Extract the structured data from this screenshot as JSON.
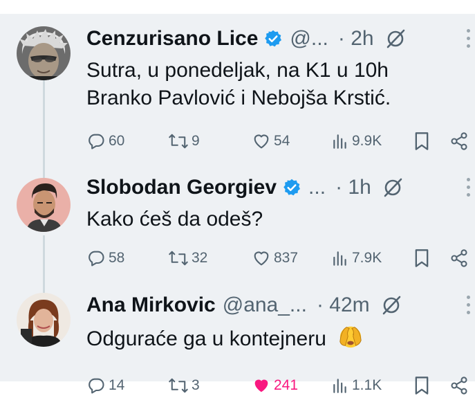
{
  "tweets": [
    {
      "name": "Cenzurisano Lice",
      "handle": "@...",
      "time": "· 2h",
      "lines": [
        "Sutra, u ponedeljak, na K1 u 10h",
        "Branko Pavlović i Nebojša Krstić."
      ],
      "replies": "60",
      "reposts": "9",
      "likes": "54",
      "views": "9.9K",
      "liked": false,
      "verified": true
    },
    {
      "name": "Slobodan Georgiev",
      "handle": "...",
      "time": "· 1h",
      "lines": [
        "Kako ćeš da odeš?"
      ],
      "replies": "58",
      "reposts": "32",
      "likes": "837",
      "views": "7.9K",
      "liked": false,
      "verified": true
    },
    {
      "name": "Ana Mirkovic",
      "handle": "@ana_...",
      "time": "· 42m",
      "lines": [
        "Odguraće ga u kontejneru"
      ],
      "replies": "14",
      "reposts": "3",
      "likes": "241",
      "views": "1.1K",
      "liked": true,
      "verified": false
    }
  ],
  "icons": {
    "reply": "reply-icon",
    "repost": "repost-icon",
    "like": "heart-icon",
    "views": "views-icon",
    "bookmark": "bookmark-icon",
    "share": "share-icon",
    "grok": "grok-icon",
    "verified": "verified-badge-icon",
    "more": "more-options-icon",
    "emoji": "face-with-peeking-eye-emoji"
  },
  "colors": {
    "background": "#eef1f4",
    "verified": "#1d9bf0",
    "liked": "#f91880",
    "muted": "#536471"
  }
}
